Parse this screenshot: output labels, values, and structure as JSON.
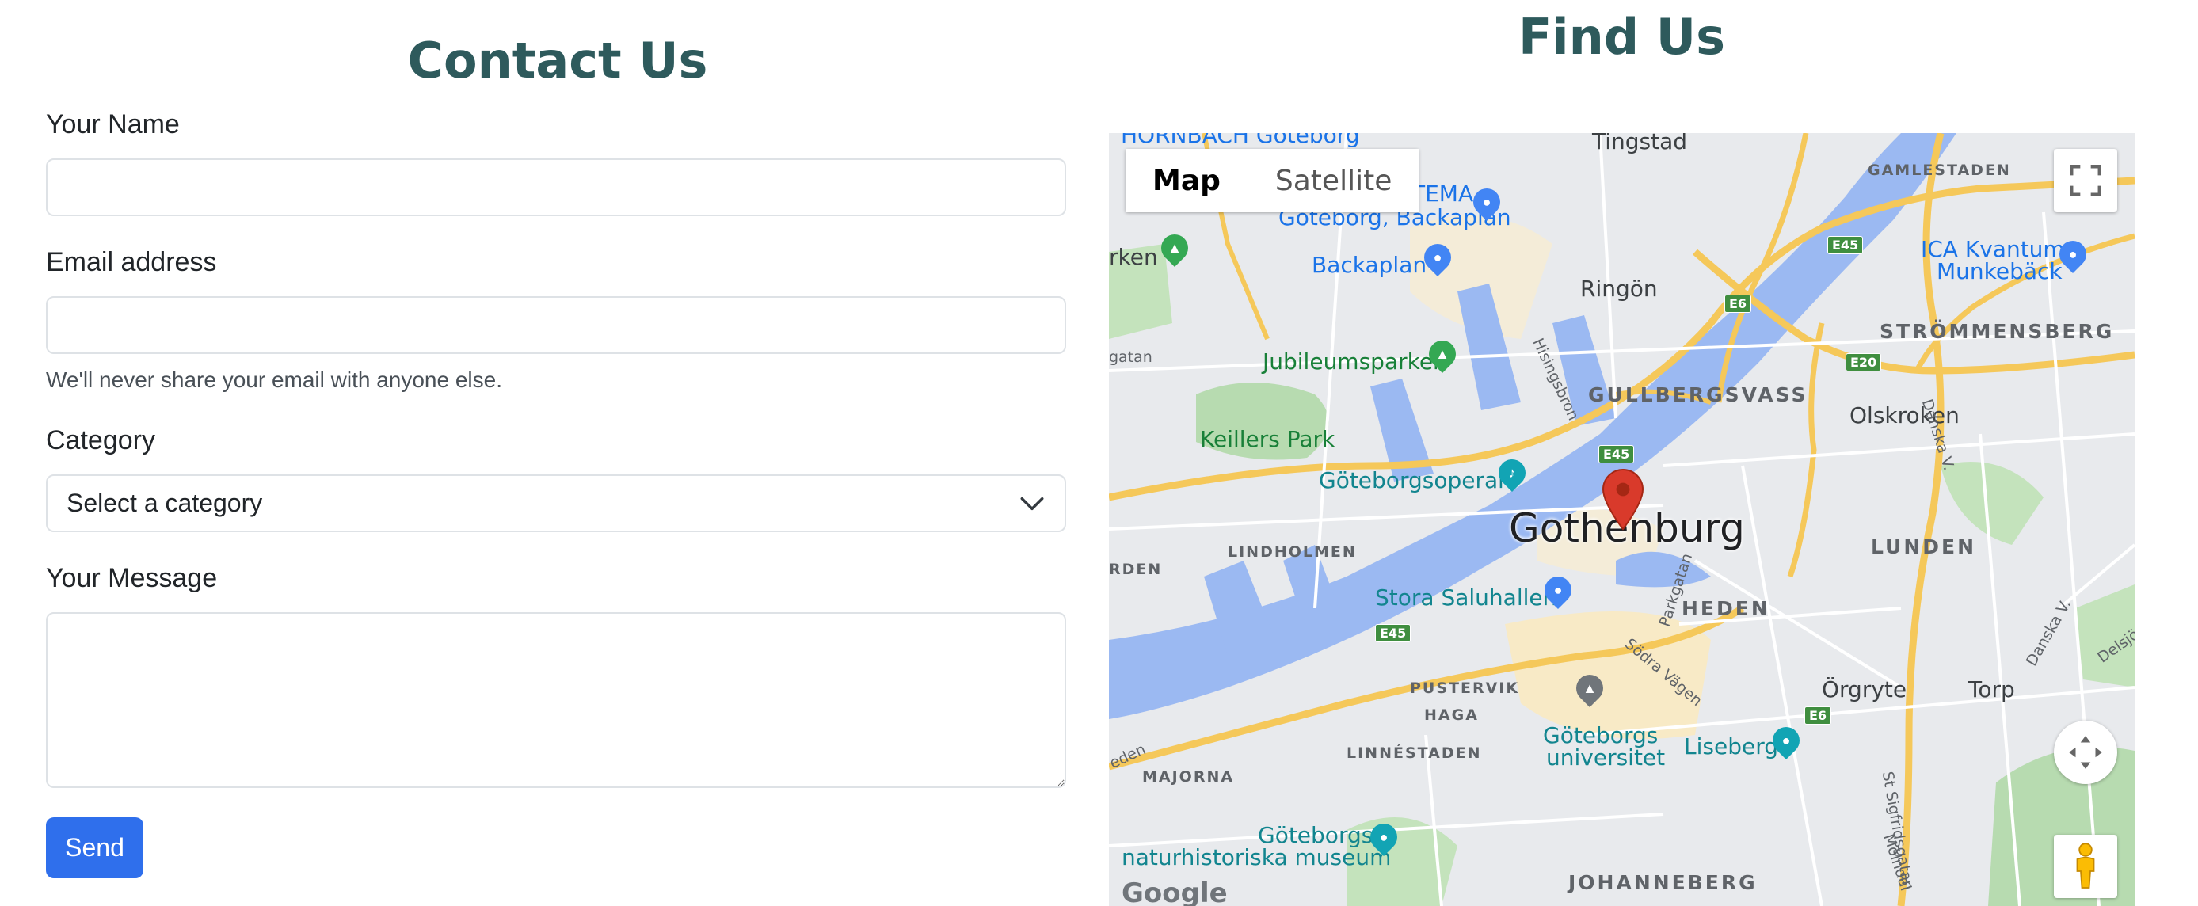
{
  "contact": {
    "title": "Contact Us",
    "name_label": "Your Name",
    "name_value": "",
    "email_label": "Email address",
    "email_value": "",
    "email_help": "We'll never share your email with anyone else.",
    "category_label": "Category",
    "category_selected": "Select a category",
    "message_label": "Your Message",
    "message_value": "",
    "send_label": "Send"
  },
  "map": {
    "title": "Find Us",
    "map_type_map": "Map",
    "map_type_satellite": "Satellite",
    "city": "Gothenburg",
    "districts": {
      "gamlestaden": "GAMLESTADEN",
      "strommensberg": "STRÖMMENSBERG",
      "gullbergsvass": "GULLBERGSVASS",
      "lindholmen": "LINDHOLMEN",
      "lunden": "LUNDEN",
      "heden": "HEDEN",
      "pustervik": "PUSTERVIK",
      "haga": "HAGA",
      "linnestaden": "LINNÉSTADEN",
      "majorna": "MAJORNA",
      "johanneberg": "JOHANNEBERG",
      "orden": "RDEN"
    },
    "places": {
      "tingstad": "Tingstad",
      "ringon": "Ringön",
      "olskroken": "Olskroken",
      "orgryte": "Örgryte",
      "torp": "Torp",
      "arken": "rken"
    },
    "pois": {
      "hornbach": "HORNBACH Göteborg",
      "iltema_1": "ILTEMA -",
      "iltema_2": "Göteborg, Backaplan",
      "backaplan": "Backaplan",
      "ica_1": "ICA Kvantum",
      "ica_2": "Munkebäck",
      "jubileumsparken": "Jubileumsparken",
      "keillers_park": "Keillers Park",
      "goteborgsoperan": "Göteborgsoperan",
      "stora_saluhallen": "Stora Saluhallen",
      "universitet_1": "Göteborgs",
      "universitet_2": "universitet",
      "liseberg": "Liseberg",
      "museum_1": "Göteborgs",
      "museum_2": "naturhistoriska museum"
    },
    "streets": {
      "hisingsbron": "Hisingsbron",
      "parkgatan": "Parkgatan",
      "sodra_vagen": "Södra Vägen",
      "danska_v1": "Danska V.",
      "danska_v2": "Danska V.",
      "delsjovagen": "Delsjövägen",
      "st_sigfridsgatan": "St Sigfridsgatan",
      "molndal": "Mölndal",
      "gatan": "gatan",
      "eden": "eden"
    },
    "shields": {
      "e45_a": "E45",
      "e6_a": "E6",
      "e20": "E20",
      "e45_b": "E45",
      "e45_c": "E45",
      "e6_b": "E6"
    },
    "google": "Google"
  },
  "colors": {
    "heading": "#2e5a5c",
    "primary": "#2f6fec",
    "water": "#9bb9f2",
    "highway": "#f5c85a",
    "park": "#b7dbb0",
    "land": "#e8eaed",
    "marker": "#d93a2b"
  }
}
